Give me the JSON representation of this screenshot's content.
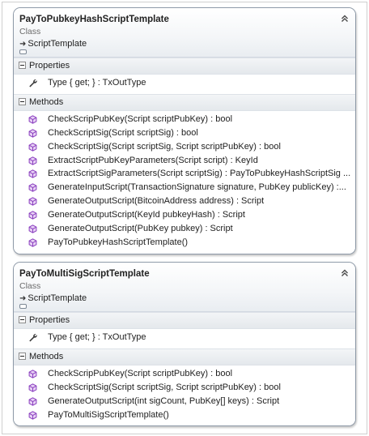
{
  "colors": {
    "card_border": "#8e9aa8",
    "header_bg": "#f4f6f8",
    "method_icon": "#8a3fbf",
    "wrench": "#3a3a3a"
  },
  "cards": [
    {
      "title": "PayToPubkeyHashScriptTemplate",
      "stereotype": "Class",
      "base": "ScriptTemplate",
      "properties_label": "Properties",
      "methods_label": "Methods",
      "properties": [
        {
          "text": "Type { get; } : TxOutType",
          "icon": "wrench-icon"
        }
      ],
      "methods": [
        {
          "text": "CheckScripPubKey(Script scriptPubKey) : bool",
          "icon": "method-icon"
        },
        {
          "text": "CheckScriptSig(Script scriptSig) : bool",
          "icon": "method-icon"
        },
        {
          "text": "CheckScriptSig(Script scriptSig, Script scriptPubKey) : bool",
          "icon": "method-icon"
        },
        {
          "text": "ExtractScriptPubKeyParameters(Script script) : KeyId",
          "icon": "method-icon"
        },
        {
          "text": "ExtractScriptSigParameters(Script  scriptSig)  :  PayToPubkeyHashScriptSig ...",
          "icon": "method-icon"
        },
        {
          "text": "GenerateInputScript(TransactionSignature  signature,  PubKey  publicKey)  :...",
          "icon": "method-icon"
        },
        {
          "text": "GenerateOutputScript(BitcoinAddress address) : Script",
          "icon": "method-icon"
        },
        {
          "text": "GenerateOutputScript(KeyId pubkeyHash) : Script",
          "icon": "method-icon"
        },
        {
          "text": "GenerateOutputScript(PubKey pubkey) : Script",
          "icon": "method-icon"
        },
        {
          "text": "PayToPubkeyHashScriptTemplate()",
          "icon": "method-icon"
        }
      ]
    },
    {
      "title": "PayToMultiSigScriptTemplate",
      "stereotype": "Class",
      "base": "ScriptTemplate",
      "properties_label": "Properties",
      "methods_label": "Methods",
      "properties": [
        {
          "text": "Type { get; } : TxOutType",
          "icon": "wrench-icon"
        }
      ],
      "methods": [
        {
          "text": "CheckScripPubKey(Script scriptPubKey) : bool",
          "icon": "method-icon"
        },
        {
          "text": "CheckScriptSig(Script scriptSig, Script scriptPubKey) : bool",
          "icon": "method-icon"
        },
        {
          "text": "GenerateOutputScript(int sigCount, PubKey[] keys) : Script",
          "icon": "method-icon"
        },
        {
          "text": "PayToMultiSigScriptTemplate()",
          "icon": "method-icon"
        }
      ]
    }
  ]
}
